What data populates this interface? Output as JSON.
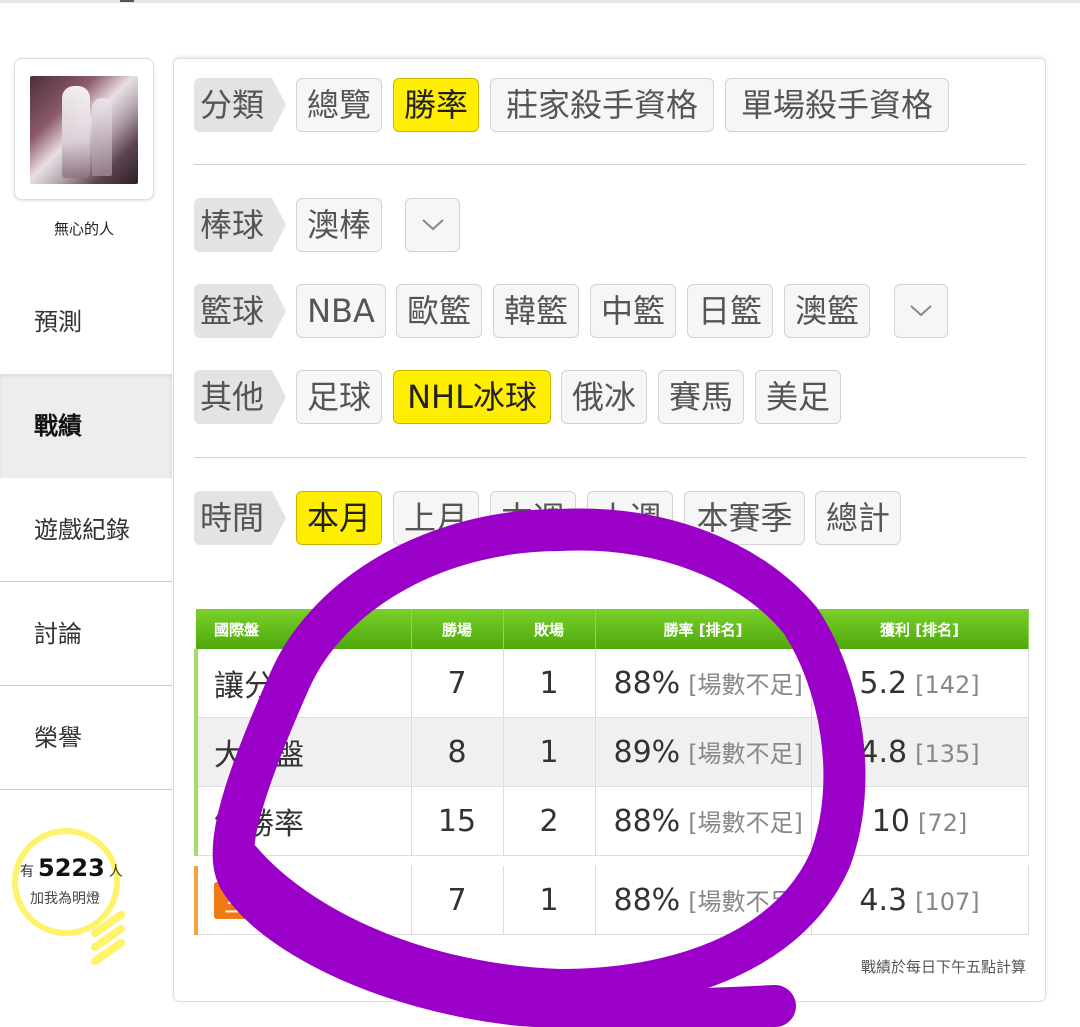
{
  "user": {
    "name": "無心的人"
  },
  "nav": [
    {
      "label": "預測",
      "active": false
    },
    {
      "label": "戰績",
      "active": true
    },
    {
      "label": "遊戲紀錄",
      "active": false
    },
    {
      "label": "討論",
      "active": false
    },
    {
      "label": "榮譽",
      "active": false
    }
  ],
  "fans": {
    "prefix": "有",
    "count": "5223",
    "suffix": "人",
    "line2": "加我為明燈"
  },
  "filters": {
    "category": {
      "label": "分類",
      "options": [
        "總覽",
        "勝率",
        "莊家殺手資格",
        "單場殺手資格"
      ],
      "selected": "勝率"
    },
    "baseball": {
      "label": "棒球",
      "options": [
        "澳棒"
      ]
    },
    "basketball": {
      "label": "籃球",
      "options": [
        "NBA",
        "歐籃",
        "韓籃",
        "中籃",
        "日籃",
        "澳籃"
      ]
    },
    "other": {
      "label": "其他",
      "options": [
        "足球",
        "NHL冰球",
        "俄冰",
        "賽馬",
        "美足"
      ],
      "selected": "NHL冰球"
    },
    "time": {
      "label": "時間",
      "options": [
        "本月",
        "上月",
        "本週",
        "上週",
        "本賽季",
        "總計"
      ],
      "selected": "本月"
    },
    "dropdown_icon": "chevron-down-icon"
  },
  "table": {
    "headers": [
      "國際盤",
      "勝場",
      "敗場",
      "勝率 [排名]",
      "獲利 [排名]"
    ],
    "rows": [
      {
        "name": "讓分",
        "wins": "7",
        "losses": "1",
        "rate": "88%",
        "rate_rank": "[場數不足]",
        "profit": "5.2",
        "profit_rank": "[142]"
      },
      {
        "name": "大小盤",
        "wins": "8",
        "losses": "1",
        "rate": "89%",
        "rate_rank": "[場數不足]",
        "profit": "4.8",
        "profit_rank": "[135]"
      },
      {
        "name": "總勝率",
        "wins": "15",
        "losses": "2",
        "rate": "88%",
        "rate_rank": "[場數不足]",
        "profit": "10",
        "profit_rank": "[72]"
      }
    ],
    "main_row": {
      "badge": "主推",
      "wins": "7",
      "losses": "1",
      "rate": "88%",
      "rate_rank": "[場數不足]",
      "profit": "4.3",
      "profit_rank": "[107]"
    }
  },
  "note": "戰績於每日下午五點計算",
  "colors": {
    "selected_chip": "#ffee00",
    "table_header": "#5cb71a",
    "annotation": "#9b00c8"
  }
}
